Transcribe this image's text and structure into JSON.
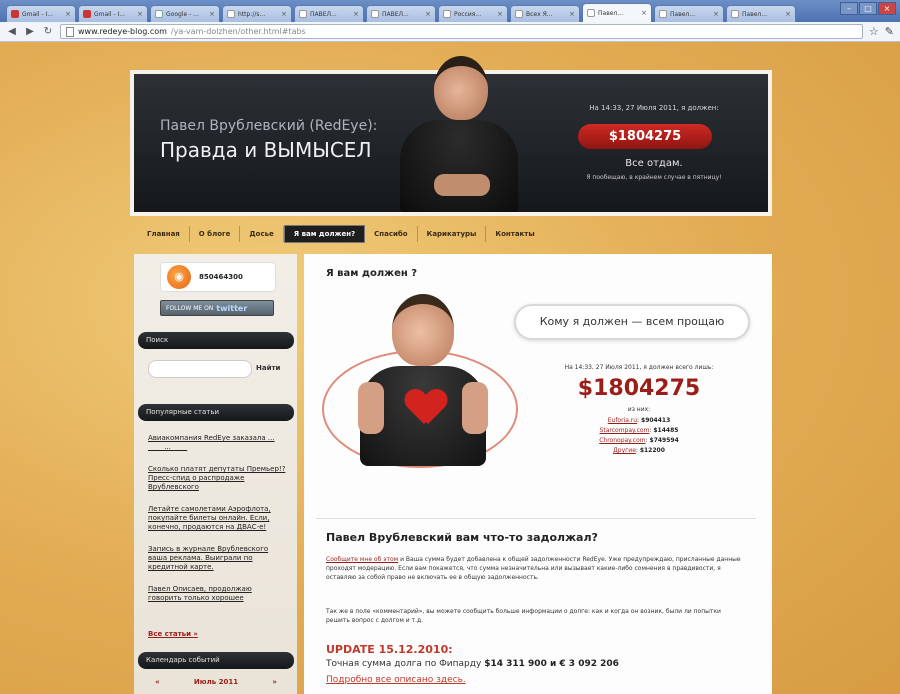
{
  "browser": {
    "tabs": [
      {
        "label": "Gmail - I...",
        "icon": "gmail-icon",
        "active": false
      },
      {
        "label": "Gmail - I...",
        "icon": "gmail-icon",
        "active": false
      },
      {
        "label": "Google - ...",
        "icon": "google-icon",
        "active": false
      },
      {
        "label": "http://s...",
        "icon": "page-icon",
        "active": false
      },
      {
        "label": "ПАВЕЛ...",
        "icon": "page-icon",
        "active": false
      },
      {
        "label": "ПАВЕЛ...",
        "icon": "page-icon",
        "active": false
      },
      {
        "label": "Россия...",
        "icon": "page-icon",
        "active": false
      },
      {
        "label": "Всех Я...",
        "icon": "page-icon",
        "active": false
      },
      {
        "label": "Павел...",
        "icon": "page-icon",
        "active": true
      },
      {
        "label": "Павел...",
        "icon": "page-icon",
        "active": false
      },
      {
        "label": "Павел...",
        "icon": "page-icon",
        "active": false
      }
    ],
    "url_host": "www.redeye-blog.com",
    "url_path": "/ya-vam-dolzhen/other.html#tabs"
  },
  "header": {
    "subtitle": "Павел Врублевский (RedEye):",
    "title": "Правда и ВЫМЫСЕЛ",
    "date_line": "На 14:33, 27 Июля 2011, я должен:",
    "amount": "$1804275",
    "give_all": "Все отдам.",
    "note": "Я пообещаю, в крайнем случае в пятницу!"
  },
  "menu": {
    "items": [
      "Главная",
      "О блоге",
      "Досье",
      "Я вам должен?",
      "Спасибо",
      "Карикатуры",
      "Контакты"
    ],
    "active_index": 3
  },
  "sidebar": {
    "rss_count": "850464300",
    "twitter_label": "FOLLOW ME ON",
    "twitter_brand": "twitter",
    "search_heading": "Поиск",
    "search_button": "Найти",
    "popular_heading": "Популярные статьи",
    "popular_links": [
      "Aвиакомпания RedEye заказала ... ____ ... ____",
      "Сколько платят депутаты Премьер!? Пресс-спид о распродаже Врублевского",
      "Летайте самолетами Аэрофлота, покупайте билеты онлайн. Если, конечно, продаются на ДВАС-е!",
      "Запись в журнале Врублевского ваша реклама. Выиграли по кредитной карте.",
      "Павел Описаев, продолжаю говорить только хорошее"
    ],
    "all_articles": "Все статьи »",
    "events_heading": "Календарь событий",
    "calendar_prev": "«",
    "calendar_month": "Июль 2011",
    "calendar_next": "»"
  },
  "content": {
    "page_title": "Я вам должен ?",
    "bubble": "Кому я должен — всем прощаю",
    "debt_date": "На 14:33, 27 Июля 2011, я должен всего лишь:",
    "debt_amount": "$1804275",
    "debt_of": "из них:",
    "debts": [
      {
        "source": "Euforia.ru",
        "value": "$904413"
      },
      {
        "source": "Starcompay.com",
        "value": "$14485"
      },
      {
        "source": "Chronopay.com",
        "value": "$749594"
      },
      {
        "source": "Другие",
        "value": "$12200"
      }
    ],
    "article_title": "Павел Врублевский вам что-то задолжал?",
    "para1_link": "Сообщите мне об этом",
    "para1_text": "и Ваша сумма будет добавлена к общей задолженности RedEye. Уже предупреждаю, присланные данные проходят модерацию. Если вам покажется, что сумма незначительна или вызывает какие-либо сомнения в правдивости, я оставляю за собой право не включать ее в общую задолженность.",
    "para2_text": "Так же в поле «комментарий», вы можете сообщить больше информации о долге: как и когда он возник, были ли попытки решить вопрос с долгом и т.д.",
    "update_title": "UPDATE 15.12.2010:",
    "update_text_prefix": "Точная сумма долга по Фипарду",
    "update_values": "$14 311 900 и € 3 092 206",
    "update_link": "Подробно все описано здесь."
  }
}
